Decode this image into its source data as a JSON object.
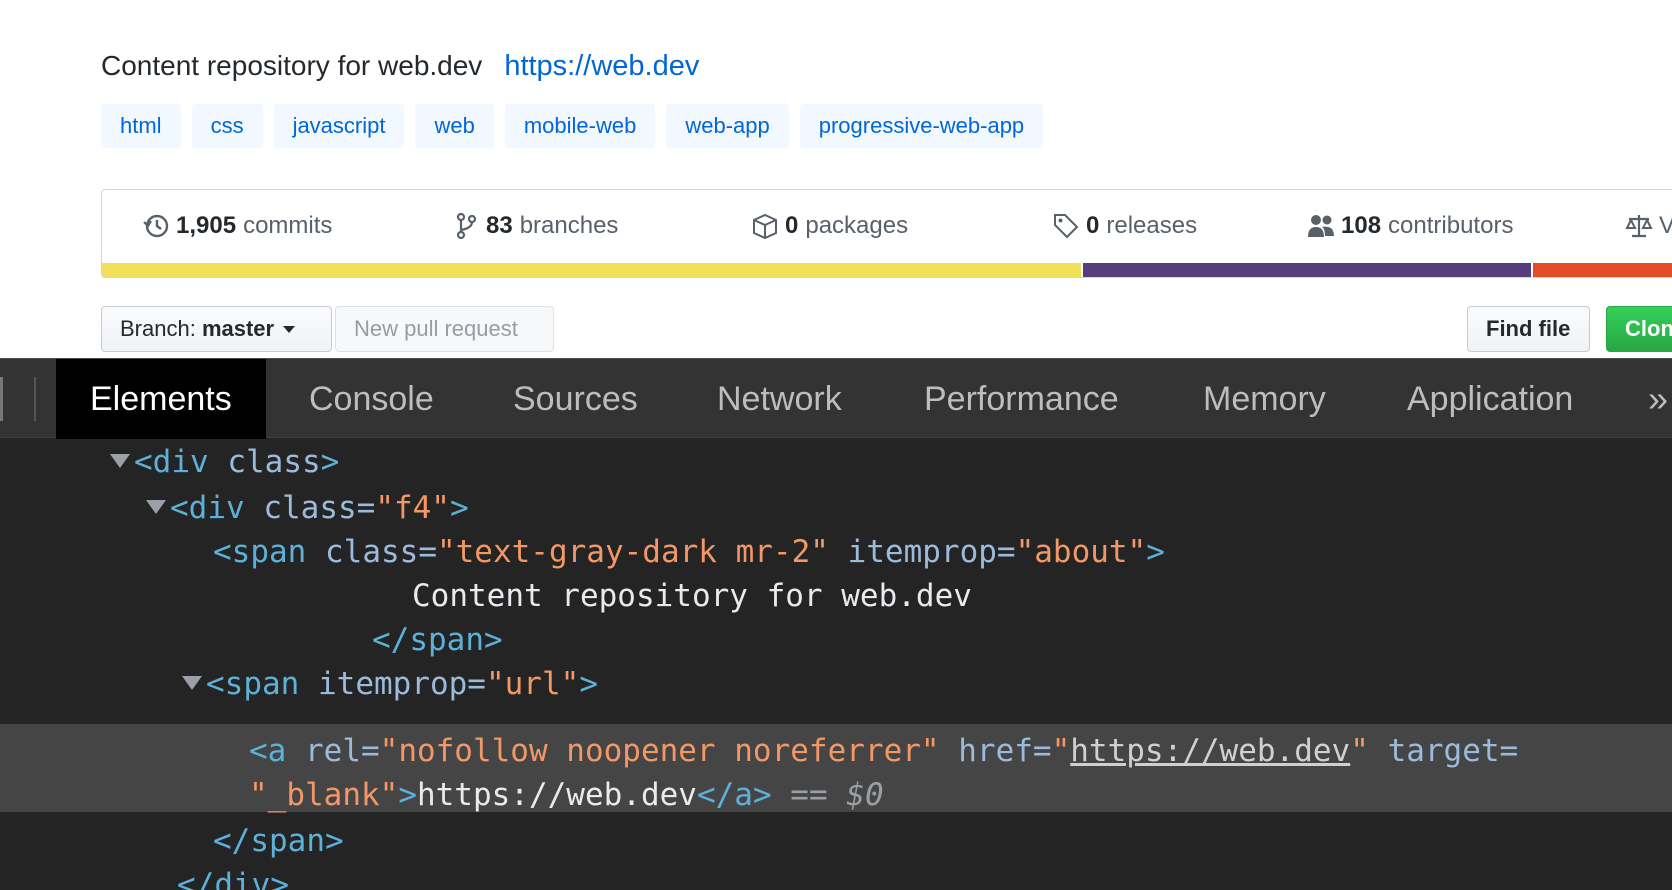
{
  "repo": {
    "description": "Content repository for web.dev",
    "url": "https://web.dev",
    "topics": [
      "html",
      "css",
      "javascript",
      "web",
      "mobile-web",
      "web-app",
      "progressive-web-app"
    ]
  },
  "summary": {
    "stats": [
      {
        "icon": "history-icon",
        "count": "1,905",
        "label": "commits"
      },
      {
        "icon": "branch-icon",
        "count": "83",
        "label": "branches"
      },
      {
        "icon": "package-icon",
        "count": "0",
        "label": "packages"
      },
      {
        "icon": "tag-icon",
        "count": "0",
        "label": "releases"
      },
      {
        "icon": "people-icon",
        "count": "108",
        "label": "contributors"
      },
      {
        "icon": "law-icon",
        "count": "",
        "label": "V"
      }
    ],
    "language_colors": [
      "#f1e05a",
      "#563d7c",
      "#e34c26"
    ]
  },
  "toolbar": {
    "branch_prefix": "Branch:",
    "branch_name": "master",
    "new_pr": "New pull request",
    "find_file": "Find file",
    "clone": "Clon"
  },
  "devtools": {
    "tabs": [
      "Elements",
      "Console",
      "Sources",
      "Network",
      "Performance",
      "Memory",
      "Application"
    ],
    "active_tab": "Elements",
    "more": "»",
    "code": {
      "l1_tag": "<div",
      "l1_attr": "class",
      "l1_close": ">",
      "l2_tag": "<div",
      "l2_attr": "class=",
      "l2_val": "\"f4\"",
      "l2_close": ">",
      "l3_tag": "<span",
      "l3_attr1": "class=",
      "l3_val1": "\"text-gray-dark mr-2\"",
      "l3_attr2": "itemprop=",
      "l3_val2": "\"about\"",
      "l3_close": ">",
      "l4_text": "Content repository for web.dev",
      "l5_close": "</span>",
      "l6_tag": "<span",
      "l6_attr": "itemprop=",
      "l6_val": "\"url\"",
      "l6_close": ">",
      "l7_tag": "<a",
      "l7_attr1": "rel=",
      "l7_val1": "\"nofollow noopener noreferrer\"",
      "l7_attr2": "href=",
      "l7_q1": "\"",
      "l7_link": "https://web.dev",
      "l7_q2": "\"",
      "l7_attr3": "target=",
      "l8_val": "\"_blank\"",
      "l8_open_close": ">",
      "l8_text": "https://web.dev",
      "l8_end_tag": "</a>",
      "l8_eq": "==",
      "l8_dollar": "$0",
      "l9_close": "</span>",
      "l10_close": "</div>"
    }
  }
}
